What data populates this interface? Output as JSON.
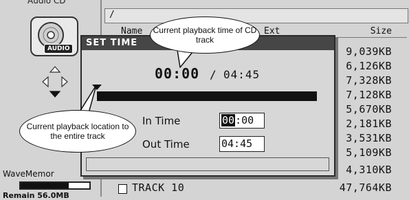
{
  "sidebar": {
    "source_label": "Audio CD",
    "cd_badge": "AUDIO",
    "wavememory_label": "WaveMemor",
    "memory_used_fraction": 0.7,
    "remain_label": "Remain  56.0MB"
  },
  "file_list": {
    "path": "/",
    "headers": {
      "name": "Name",
      "ext": "Ext",
      "size": "Size"
    },
    "sizes": [
      "9,039KB",
      "6,126KB",
      "7,328KB",
      "7,128KB",
      "5,670KB",
      "2,181KB",
      "3,531KB",
      "5,109KB",
      "4,310KB"
    ],
    "last_track": {
      "name": "TRACK 10",
      "size": "47,764KB"
    }
  },
  "dialog": {
    "title": "SET TIME",
    "current_time": "00:00",
    "separator": "/",
    "total_time": "04:45",
    "playhead_fraction": 0.0,
    "in_time_label": "In Time",
    "in_time_selected": "00",
    "in_time_rest": ":00",
    "out_time_label": "Out Time",
    "out_time": "04:45"
  },
  "callouts": {
    "time": "Current playback time of CD track",
    "location": "Current playback location to the entire track"
  },
  "colors": {
    "background": "#d4d4d4",
    "titlebar": "#464646",
    "bar": "#111111"
  }
}
